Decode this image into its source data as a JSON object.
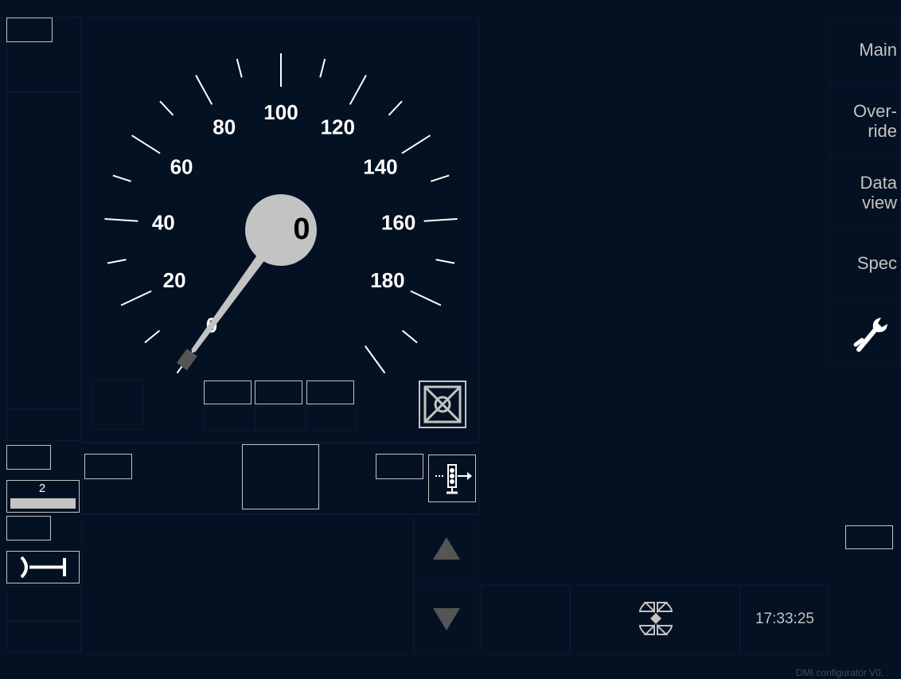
{
  "speedometer": {
    "scale_labels": [
      "0",
      "20",
      "40",
      "60",
      "80",
      "100",
      "120",
      "140",
      "160",
      "180"
    ],
    "current_speed": "0",
    "speed_kmh": 0,
    "max_speed": 200
  },
  "left_panel": {
    "level_number": "2"
  },
  "menu": {
    "main": "Main",
    "override_line1": "Over-",
    "override_line2": "ride",
    "dataview_line1": "Data",
    "dataview_line2": "view",
    "spec": "Spec"
  },
  "status_bar": {
    "time": "17:33:25",
    "version": "DMI configurator V0."
  },
  "colors": {
    "background": "#031122",
    "grey": "#c3c3c3",
    "dark_grey": "#555555",
    "white": "#ffffff"
  },
  "icons": [
    "wrench-icon",
    "arrow-up-icon",
    "arrow-down-icon",
    "signal-icon",
    "brake-icon",
    "tunnel-icon",
    "connection-icon"
  ]
}
